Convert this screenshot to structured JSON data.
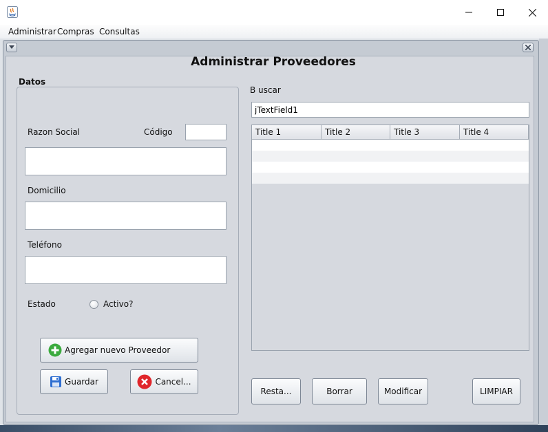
{
  "window": {
    "minimize": "—",
    "maximize": "☐",
    "close": "✕"
  },
  "menu": [
    "Administrar",
    "Compras",
    "Consultas"
  ],
  "frame": {
    "title": "Administrar Proveedores"
  },
  "datos": {
    "title": "Datos",
    "razon_social_label": "Razon Social",
    "codigo_label": "Código",
    "codigo_value": "",
    "razon_social_value": "",
    "domicilio_label": "Domicilio",
    "domicilio_value": "",
    "telefono_label": "Teléfono",
    "telefono_value": "",
    "estado_label": "Estado",
    "activo_label": "Activo?",
    "activo_checked": false,
    "add_button": "Agregar nuevo Proveedor",
    "save_button": "Guardar",
    "cancel_button": "Cancel..."
  },
  "search": {
    "label": "B uscar",
    "value": "jTextField1"
  },
  "table": {
    "columns": [
      "Title 1",
      "Title 2",
      "Title 3",
      "Title 4"
    ],
    "rows": [
      [
        "",
        "",
        "",
        ""
      ],
      [
        "",
        "",
        "",
        ""
      ],
      [
        "",
        "",
        "",
        ""
      ],
      [
        "",
        "",
        "",
        ""
      ]
    ]
  },
  "actions": {
    "restore": "Resta...",
    "delete": "Borrar",
    "modify": "Modificar",
    "clear": "LIMPIAR"
  },
  "colors": {
    "add_icon": "#3cab3f",
    "save_icon": "#2f6fd1",
    "cancel_icon": "#e0262b",
    "panel": "#d6d9df"
  }
}
